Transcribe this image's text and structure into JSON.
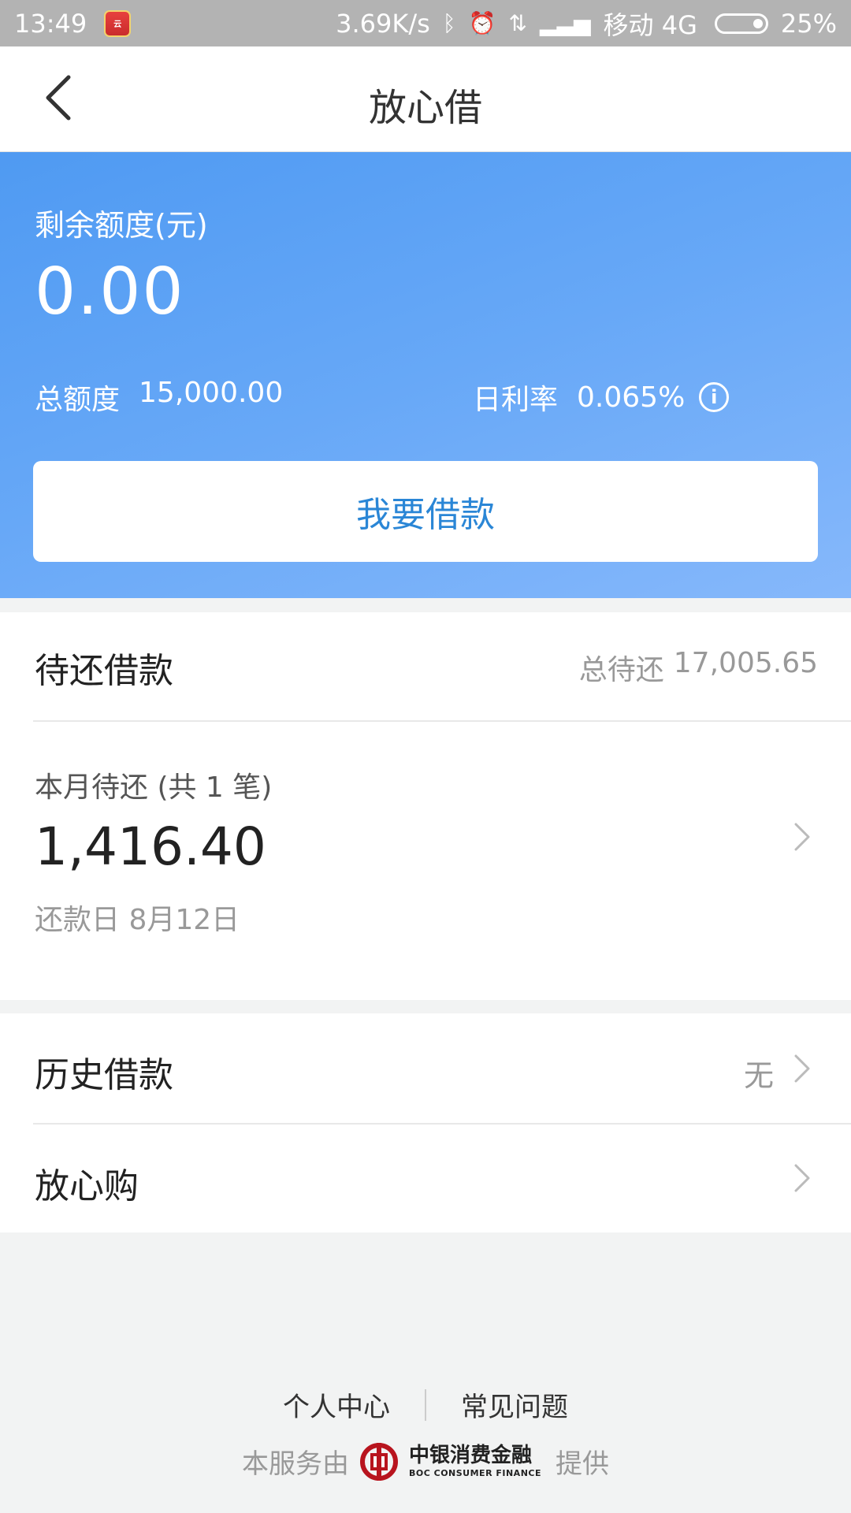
{
  "status_bar": {
    "time": "13:49",
    "notification_app_icon": "unionpay-app-icon",
    "speed": "3.69K/s",
    "bluetooth_icon": "bluetooth-icon",
    "alarm_icon": "alarm-icon",
    "data_icon": "data-arrows-icon",
    "signal_icon": "signal-icon",
    "carrier": "移动 4G",
    "battery": "25%"
  },
  "header": {
    "title": "放心借",
    "back_icon": "chevron-left-icon"
  },
  "quota": {
    "label": "剩余额度(元)",
    "value": "0.00",
    "total_label": "总额度",
    "total_value": "15,000.00",
    "rate_label": "日利率",
    "rate_value": "0.065%",
    "info_icon": "info-icon",
    "borrow_button": "我要借款"
  },
  "pending": {
    "title": "待还借款",
    "total_label": "总待还",
    "total_value": "17,005.65",
    "month_label": "本月待还 (共 1 笔)",
    "month_amount": "1,416.40",
    "repay_date": "还款日 8月12日"
  },
  "menu": {
    "history_label": "历史借款",
    "history_value": "无",
    "shop_label": "放心购"
  },
  "footer": {
    "personal_center": "个人中心",
    "faq": "常见问题",
    "provider_prefix": "本服务由",
    "provider_name": "中银消费金融",
    "provider_name_en": "BOC CONSUMER FINANCE",
    "provider_suffix": "提供"
  },
  "colors": {
    "card_gradient_start": "#4f9af2",
    "card_gradient_end": "#86b8fb",
    "button_text": "#2a86d6",
    "boc_red": "#b8141e"
  }
}
